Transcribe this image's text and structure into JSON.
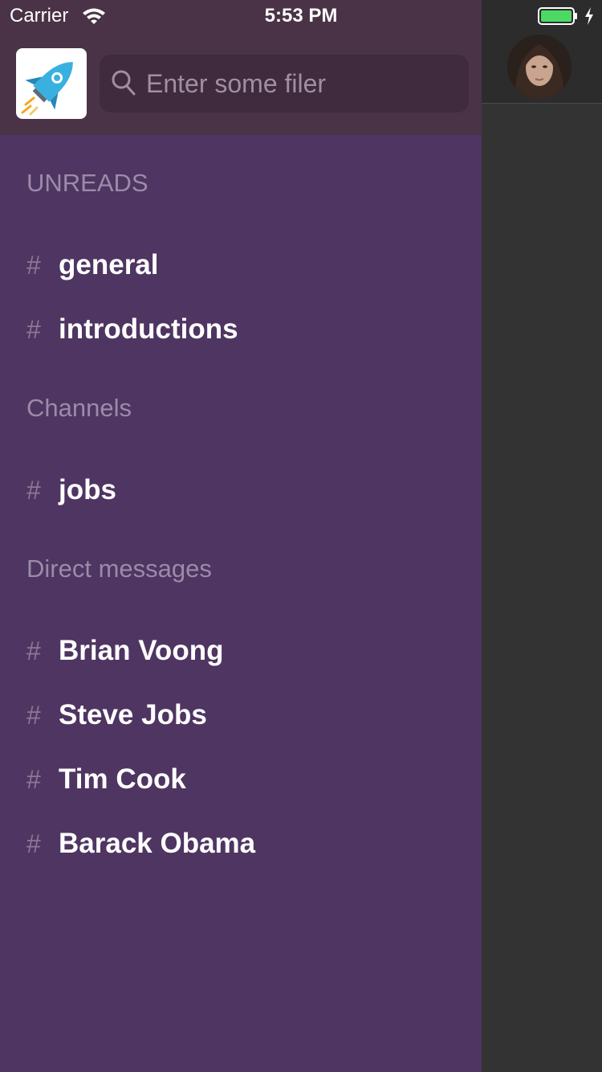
{
  "status_bar": {
    "carrier": "Carrier",
    "time": "5:53 PM",
    "icons": [
      "wifi-icon",
      "battery-icon",
      "charging-bolt-icon"
    ],
    "battery_color": "#4cd964"
  },
  "drawer": {
    "logo_icon": "rocket-icon",
    "search": {
      "placeholder": "Enter some filer",
      "value": "",
      "icon": "search-icon"
    },
    "sections": {
      "unreads": {
        "title": "UNREADS",
        "items": [
          {
            "label": "general"
          },
          {
            "label": "introductions"
          }
        ]
      },
      "channels": {
        "title": "Channels",
        "items": [
          {
            "label": "jobs"
          }
        ]
      },
      "direct_messages": {
        "title": "Direct messages",
        "items": [
          {
            "label": "Brian Voong"
          },
          {
            "label": "Steve Jobs"
          },
          {
            "label": "Tim Cook"
          },
          {
            "label": "Barack Obama"
          }
        ]
      }
    },
    "item_prefix": "#",
    "colors": {
      "drawer_bg": "#4f3562",
      "header_bg": "#4a3346",
      "search_bg": "#3f2a3e",
      "section_title": "#9b8ba9"
    }
  },
  "content": {
    "avatar_icon": "user-avatar"
  }
}
